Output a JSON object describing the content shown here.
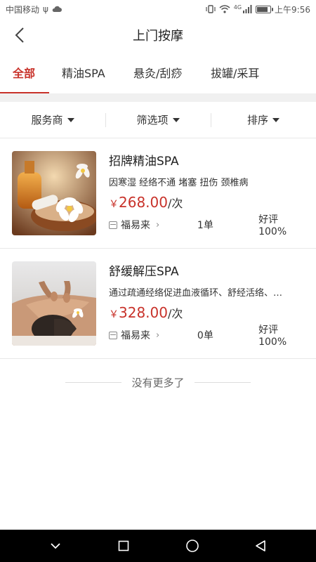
{
  "status_bar": {
    "carrier": "中国移动",
    "usb": "ψ",
    "signal_label": "4G",
    "time": "上午9:56",
    "battery_level": 0.9
  },
  "header": {
    "title": "上门按摩",
    "back_icon": "chevron-left-icon"
  },
  "tabs": [
    {
      "label": "全部",
      "active": true
    },
    {
      "label": "精油SPA",
      "active": false
    },
    {
      "label": "悬灸/刮痧",
      "active": false
    },
    {
      "label": "拔罐/采耳",
      "active": false
    }
  ],
  "filters": [
    {
      "label": "服务商"
    },
    {
      "label": "筛选项"
    },
    {
      "label": "排序"
    }
  ],
  "services": [
    {
      "name": "招牌精油SPA",
      "desc": "因寒湿 经络不通 堵塞 扭伤 颈椎病",
      "currency": "￥",
      "price": "268.00",
      "unit": "/次",
      "shop": "福易来",
      "orders": "1单",
      "rating": "好评100%"
    },
    {
      "name": "舒缓解压SPA",
      "desc": "通过疏通经络促进血液循环、舒经活络、…",
      "currency": "￥",
      "price": "328.00",
      "unit": "/次",
      "shop": "福易来",
      "orders": "0单",
      "rating": "好评100%"
    }
  ],
  "footer": {
    "no_more": "没有更多了"
  },
  "colors": {
    "accent": "#c8322a",
    "background": "#ffffff",
    "separator": "#f0f0f0"
  }
}
